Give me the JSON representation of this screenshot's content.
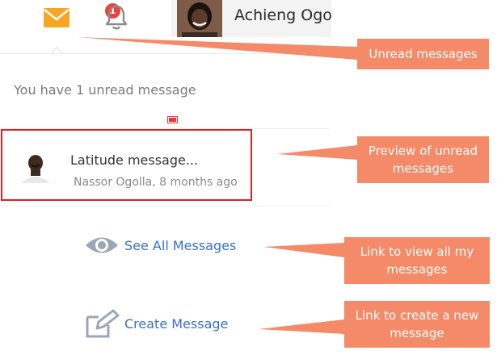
{
  "topbar": {
    "mail_badge_count": "1",
    "user_name": "Achieng Ogo"
  },
  "dropdown": {
    "heading": "You have 1 unread message",
    "message": {
      "subject": "Latitude message...",
      "meta": "Nassor Ogolla, 8 months ago"
    },
    "see_all_label": "See All Messages",
    "create_label": "Create Message"
  },
  "callouts": {
    "unread": "Unread messages",
    "preview": "Preview of unread messages",
    "view_all": "Link to view all my messages",
    "create": "Link to create a new message"
  },
  "colors": {
    "mail_icon": "#f6a623",
    "badge": "#e8443b",
    "link": "#3a6ec8",
    "callout": "#f58a68",
    "highlight_border": "#e02020"
  },
  "icons": {
    "mail": "envelope-icon",
    "bell": "bell-icon",
    "see_all": "eye-icon",
    "create": "edit-icon"
  }
}
